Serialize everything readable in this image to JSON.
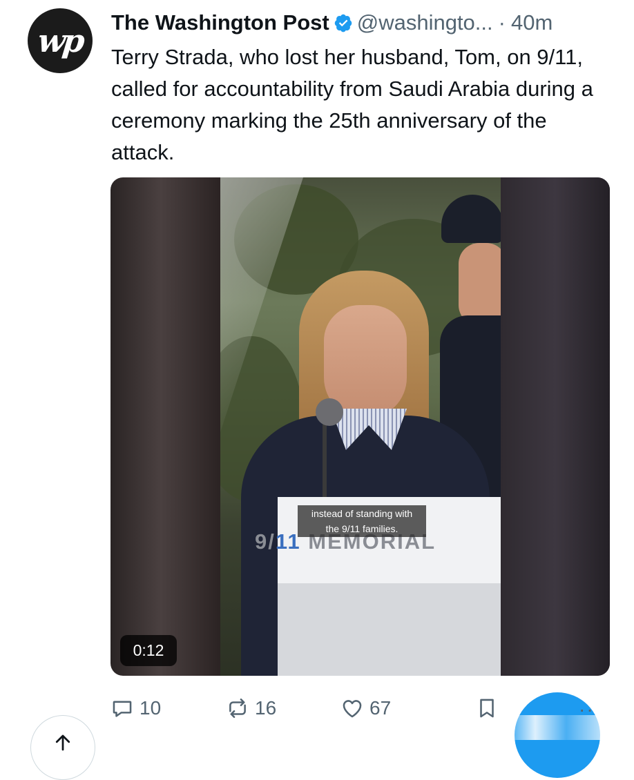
{
  "tweet": {
    "author": "The Washington Post",
    "handle": "@washingto...",
    "separator": "·",
    "time": "40m",
    "text": "Terry Strada, who lost her husband, Tom, on 9/11, called for accountability from Saudi Arabia during a ceremony marking the 25th anniversary of the attack.",
    "avatar_text": "wp"
  },
  "media": {
    "caption_line1": "instead of standing with",
    "caption_line2": "the 9/11 families.",
    "podium_logo_part1": "9/",
    "podium_logo_part2": "11",
    "podium_logo_part3": " MEMORIAL",
    "duration": "0:12"
  },
  "actions": {
    "replies": "10",
    "reposts": "16",
    "likes": "67",
    "more": "··"
  },
  "icons": {
    "avatar": "washington-post-logo",
    "verified": "verified-badge-icon",
    "reply": "reply-icon",
    "repost": "repost-icon",
    "like": "heart-icon",
    "bookmark": "bookmark-icon",
    "scroll_top": "arrow-up-icon"
  },
  "colors": {
    "accent": "#1d9bf0",
    "secondary_text": "#536471"
  }
}
